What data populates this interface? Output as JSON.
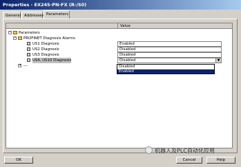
{
  "window": {
    "title": "Properties - EX245-PN-FX (R-/S0)"
  },
  "tabs": [
    {
      "label": "General"
    },
    {
      "label": "Addresses"
    },
    {
      "label": "Parameters"
    }
  ],
  "grid": {
    "header_value": "Value",
    "tree": {
      "root": "Parameters",
      "group": "PROFINET Diagnosis Alarms",
      "items": [
        {
          "label": "US1 Diagnosis",
          "value": "Enabled"
        },
        {
          "label": "US2 Diagnosis",
          "value": "Disabled"
        },
        {
          "label": "US3 Diagnosis",
          "value": "Disabled"
        },
        {
          "label": "US4, US10 Diagnosis",
          "value": "Disabled"
        }
      ],
      "collapsed_node": "---"
    }
  },
  "dropdown": {
    "options": [
      "Disabled",
      "Enabled"
    ],
    "highlighted": "Enabled"
  },
  "buttons": {
    "ok": "OK",
    "cancel": "Cancel",
    "help": "Help"
  },
  "watermark": {
    "text": "机器人及PLC自动化应用"
  }
}
